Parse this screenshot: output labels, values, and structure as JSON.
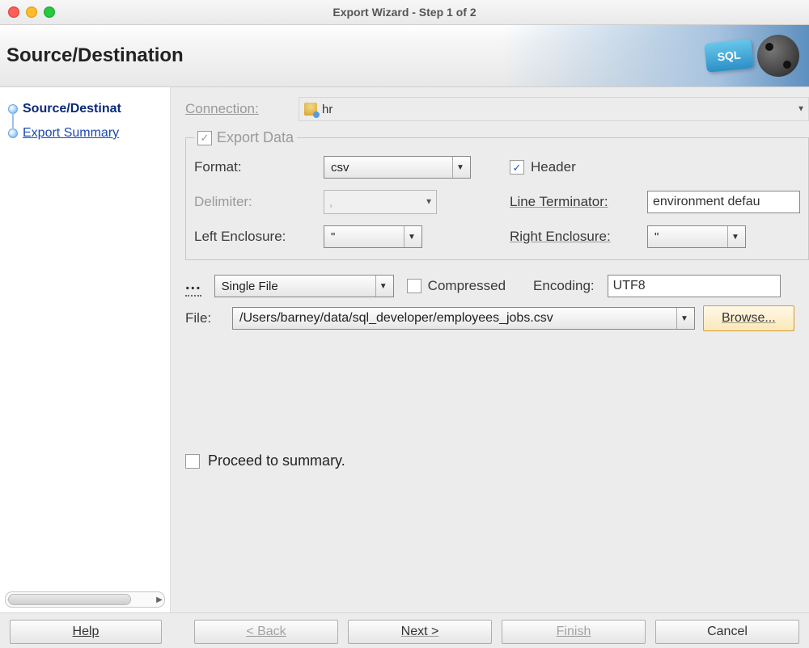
{
  "window": {
    "title": "Export Wizard - Step 1 of 2"
  },
  "banner": {
    "title": "Source/Destination",
    "badge_text": "SQL"
  },
  "steps": [
    {
      "label": "Source/Destinat",
      "active": true
    },
    {
      "label": "Export Summary",
      "active": false
    }
  ],
  "connection": {
    "label": "Connection:",
    "value": "hr"
  },
  "export_data": {
    "legend": "Export Data",
    "checked": true,
    "format_label": "Format:",
    "format_value": "csv",
    "header_label": "Header",
    "header_checked": true,
    "delimiter_label": "Delimiter:",
    "delimiter_value": ",",
    "line_terminator_label": "Line Terminator:",
    "line_terminator_value": "environment defau",
    "left_enclosure_label": "Left Enclosure:",
    "left_enclosure_value": "\"",
    "right_enclosure_label": "Right Enclosure:",
    "right_enclosure_value": "\""
  },
  "file_section": {
    "save_as_dots": "...",
    "save_as_value": "Single File",
    "compressed_label": "Compressed",
    "compressed_checked": false,
    "encoding_label": "Encoding:",
    "encoding_value": "UTF8",
    "file_label": "File:",
    "file_value": "/Users/barney/data/sql_developer/employees_jobs.csv",
    "browse_label": "Browse..."
  },
  "proceed": {
    "label": "Proceed to summary.",
    "checked": false
  },
  "footer": {
    "help": "Help",
    "back": "< Back",
    "next": "Next >",
    "finish": "Finish",
    "cancel": "Cancel"
  }
}
